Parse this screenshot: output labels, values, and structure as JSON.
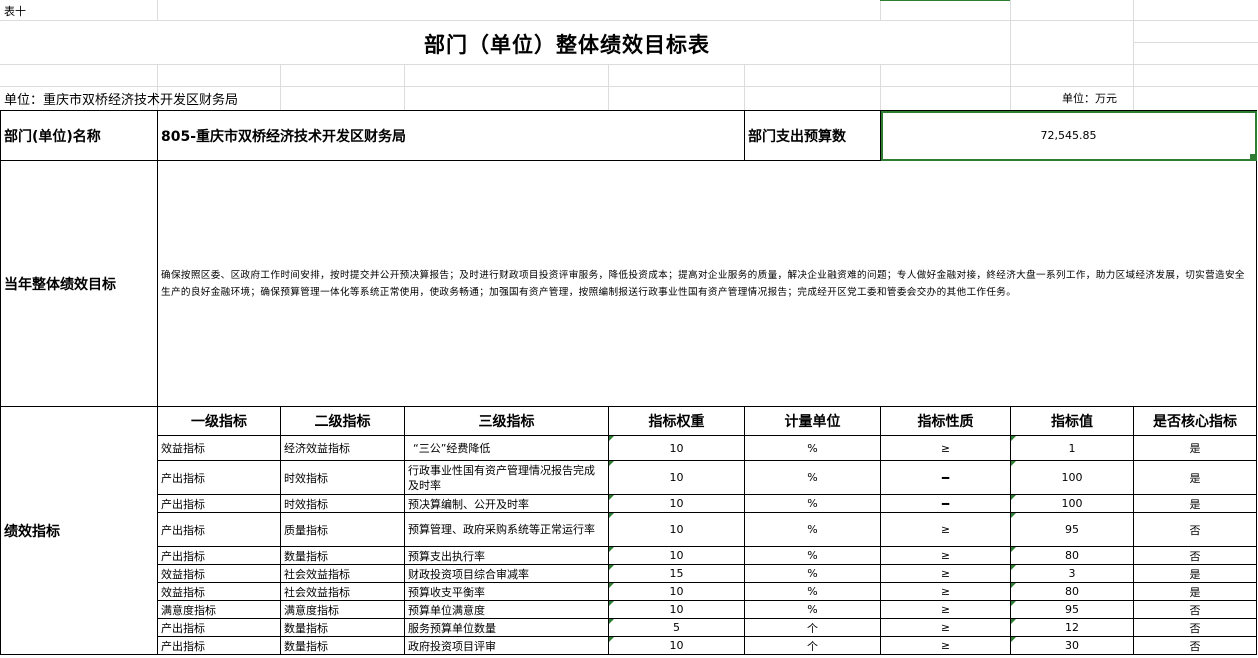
{
  "sheet": {
    "table_number": "表十",
    "title": "部门（单位）整体绩效目标表",
    "unit_left": "单位：重庆市双桥经济技术开发区财务局",
    "unit_right": "单位：万元"
  },
  "header": {
    "dept_label": "部门(单位)名称",
    "dept_value": "805-重庆市双桥经济技术开发区财务局",
    "budget_label": "部门支出预算数",
    "budget_value": "72,545.85"
  },
  "goal": {
    "label": "当年整体绩效目标",
    "text": "确保按照区委、区政府工作时间安排，按时提交并公开预决算报告；及时进行财政项目投资评审服务，降低投资成本；提高对企业服务的质量，解决企业融资难的问题；专人做好金融对接，終经济大盘一系列工作，助力区域经济发展，切实营造安全生产的良好金融环境；确保预算管理一体化等系统正常使用，使政务畅通；加强国有资产管理，按照编制报送行政事业性国有资产管理情况报告；完成经开区党工委和管委会交办的其他工作任务。"
  },
  "indicators": {
    "label": "绩效指标",
    "columns": [
      "一级指标",
      "二级指标",
      "三级指标",
      "指标权重",
      "计量单位",
      "指标性质",
      "指标值",
      "是否核心指标"
    ],
    "rows": [
      {
        "l1": "效益指标",
        "l2": "经济效益指标",
        "l3": "“三公”经费降低",
        "weight": "10",
        "unit": "%",
        "nature": "≥",
        "value": "1",
        "core": "是"
      },
      {
        "l1": "产出指标",
        "l2": "时效指标",
        "l3": "行政事业性国有资产管理情况报告完成及时率",
        "weight": "10",
        "unit": "%",
        "nature": "━",
        "value": "100",
        "core": "是"
      },
      {
        "l1": "产出指标",
        "l2": "时效指标",
        "l3": "预决算编制、公开及时率",
        "weight": "10",
        "unit": "%",
        "nature": "━",
        "value": "100",
        "core": "是"
      },
      {
        "l1": "产出指标",
        "l2": "质量指标",
        "l3": "预算管理、政府采购系统等正常运行率",
        "weight": "10",
        "unit": "%",
        "nature": "≥",
        "value": "95",
        "core": "否"
      },
      {
        "l1": "产出指标",
        "l2": "数量指标",
        "l3": "预算支出执行率",
        "weight": "10",
        "unit": "%",
        "nature": "≥",
        "value": "80",
        "core": "否"
      },
      {
        "l1": "效益指标",
        "l2": "社会效益指标",
        "l3": "财政投资项目综合审减率",
        "weight": "15",
        "unit": "%",
        "nature": "≥",
        "value": "3",
        "core": "是"
      },
      {
        "l1": "效益指标",
        "l2": "社会效益指标",
        "l3": "预算收支平衡率",
        "weight": "10",
        "unit": "%",
        "nature": "≥",
        "value": "80",
        "core": "是"
      },
      {
        "l1": "满意度指标",
        "l2": "满意度指标",
        "l3": "预算单位满意度",
        "weight": "10",
        "unit": "%",
        "nature": "≥",
        "value": "95",
        "core": "否"
      },
      {
        "l1": "产出指标",
        "l2": "数量指标",
        "l3": "服务预算单位数量",
        "weight": "5",
        "unit": "个",
        "nature": "≥",
        "value": "12",
        "core": "否"
      },
      {
        "l1": "产出指标",
        "l2": "数量指标",
        "l3": "政府投资项目评审",
        "weight": "10",
        "unit": "个",
        "nature": "≥",
        "value": "30",
        "core": "否"
      }
    ]
  },
  "colors": {
    "selection": "#2e7d32",
    "gridline": "#dcdcdc"
  }
}
